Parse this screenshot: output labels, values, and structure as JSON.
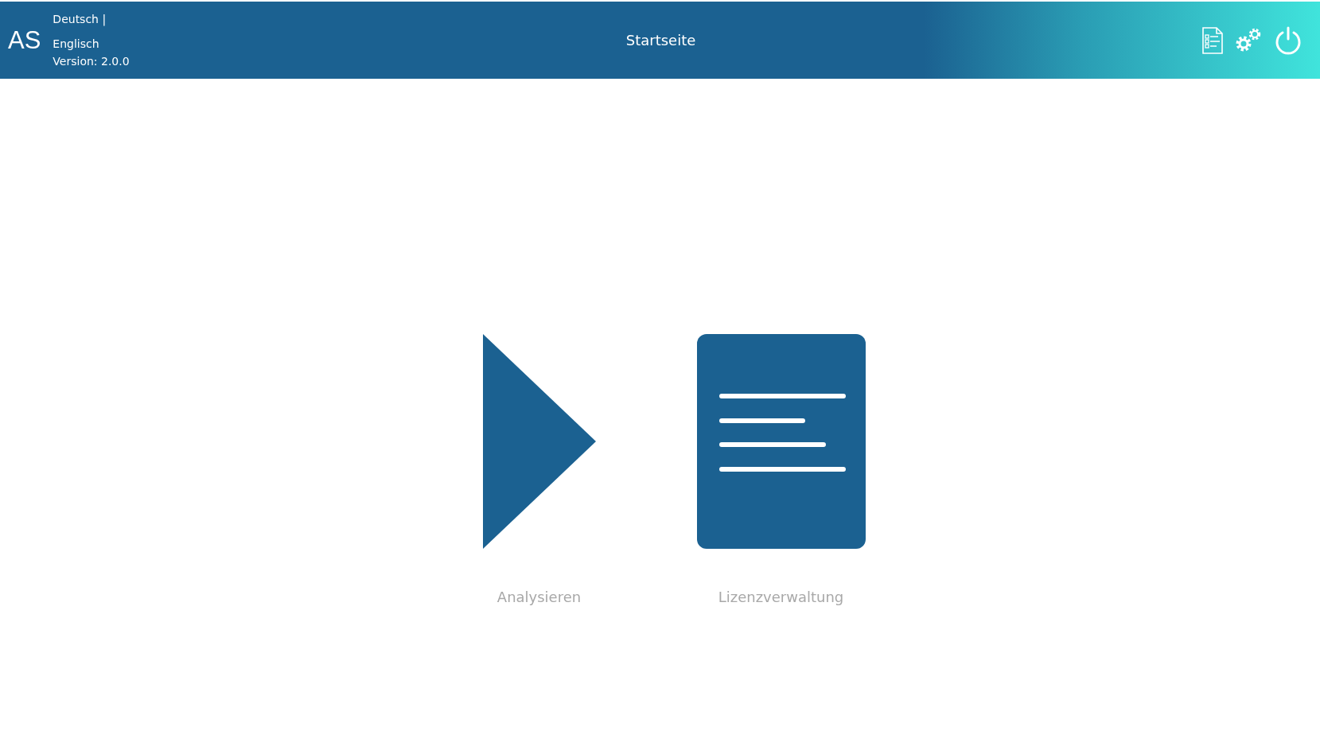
{
  "header": {
    "logo": "AS",
    "languages": [
      {
        "label": "Deutsch |"
      },
      {
        "label": "Englisch"
      }
    ],
    "version": "Version: 2.0.0",
    "title": "Startseite",
    "actions": [
      {
        "kind": "checklist"
      },
      {
        "kind": "gears"
      },
      {
        "kind": "power"
      }
    ]
  },
  "tiles": [
    {
      "kind": "play",
      "label": "Analysieren"
    },
    {
      "kind": "document",
      "label": "Lizenzverwaltung"
    }
  ]
}
